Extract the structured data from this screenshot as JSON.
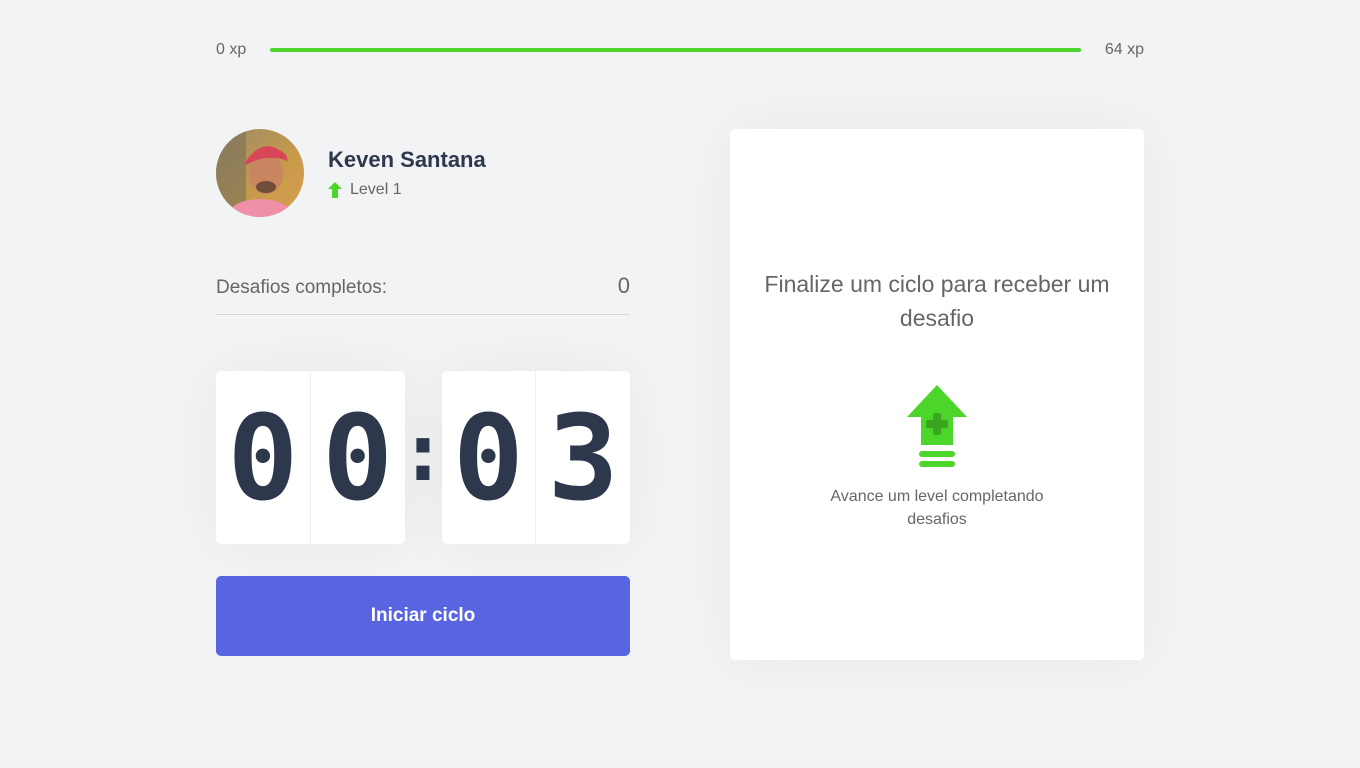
{
  "xp": {
    "start_label": "0 xp",
    "end_label": "64 xp",
    "progress_fraction": 1.0
  },
  "profile": {
    "name": "Keven Santana",
    "level_label": "Level 1"
  },
  "completed": {
    "label": "Desafios completos:",
    "count": "0"
  },
  "countdown": {
    "minute_left": "0",
    "minute_right": "0",
    "separator": ":",
    "second_left": "0",
    "second_right": "3"
  },
  "start_button": {
    "label": "Iniciar ciclo"
  },
  "challenge": {
    "title": "Finalize um ciclo para receber um desafio",
    "hint": "Avance um level completando desafios",
    "icon": "level-up-icon"
  },
  "colors": {
    "accent_green": "#4cd62b",
    "button_blue": "#5965e0",
    "text_dark": "#2e384d",
    "background": "#f2f3f5"
  }
}
